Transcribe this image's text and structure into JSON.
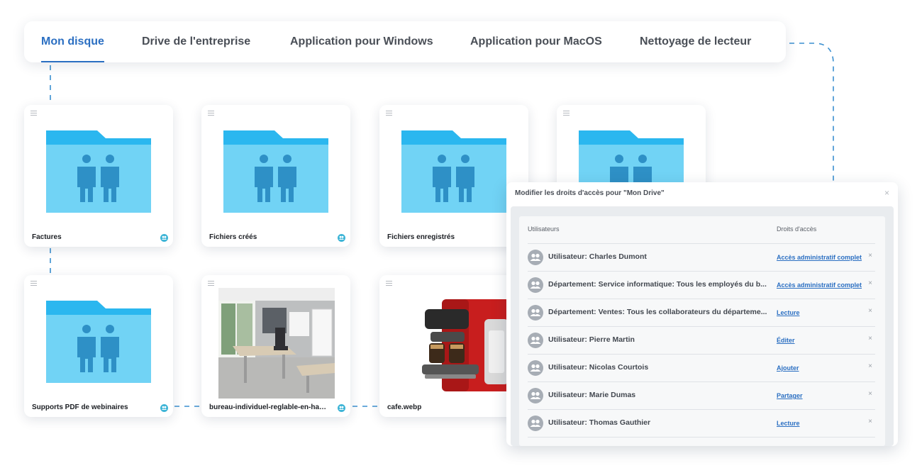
{
  "tabs": [
    {
      "label": "Mon disque",
      "active": true
    },
    {
      "label": "Drive de l'entreprise",
      "active": false
    },
    {
      "label": "Application pour Windows",
      "active": false
    },
    {
      "label": "Application pour MacOS",
      "active": false
    },
    {
      "label": "Nettoyage de lecteur",
      "active": false
    }
  ],
  "files": [
    {
      "name": "Factures",
      "type": "shared-folder",
      "shared": true
    },
    {
      "name": "Fichiers créés",
      "type": "shared-folder",
      "shared": true
    },
    {
      "name": "Fichiers enregistrés",
      "type": "shared-folder",
      "shared": false
    },
    {
      "name": "",
      "type": "shared-folder",
      "shared": false
    },
    {
      "name": "Supports PDF de webinaires",
      "type": "shared-folder",
      "shared": true
    },
    {
      "name": "bureau-individuel-reglable-en-hauteur",
      "type": "image",
      "shared": true
    },
    {
      "name": "cafe.webp",
      "type": "image",
      "shared": false
    }
  ],
  "dialog": {
    "title": "Modifier les droits d'accès pour \"Mon Drive\"",
    "close_label": "×",
    "col_users": "Utilisateurs",
    "col_rights": "Droits d'accès",
    "remove_label": "×",
    "rows": [
      {
        "user": "Utilisateur: Charles Dumont",
        "access": "Accès administratif complet"
      },
      {
        "user": "Département: Service informatique: Tous les employés du b...",
        "access": "Accès administratif complet"
      },
      {
        "user": "Département: Ventes: Tous les collaborateurs du départeme...",
        "access": "Lecture"
      },
      {
        "user": "Utilisateur: Pierre Martin",
        "access": "Éditer"
      },
      {
        "user": "Utilisateur: Nicolas Courtois",
        "access": "Ajouter"
      },
      {
        "user": "Utilisateur: Marie Dumas",
        "access": "Partager"
      },
      {
        "user": "Utilisateur: Thomas Gauthier",
        "access": "Lecture"
      }
    ]
  },
  "colors": {
    "accent": "#2b6fc2",
    "folder_body": "#71d3f5",
    "folder_tab": "#2bb7ef",
    "folder_people": "#2e90c6",
    "connector": "#3a8fd0"
  },
  "icons": {
    "folder": "shared-folder-icon",
    "shared": "shared-users-icon",
    "avatar": "group-avatar-icon",
    "menu": "hamburger-menu-icon",
    "close": "close-icon"
  }
}
